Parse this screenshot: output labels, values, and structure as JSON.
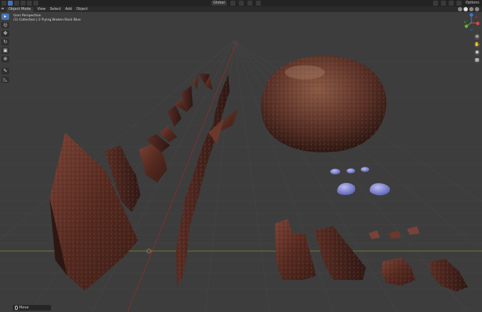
{
  "header": {
    "orientation_label": "Global",
    "options_label": "Options"
  },
  "menubar": {
    "mode": "Object Mode",
    "menus": [
      "View",
      "Select",
      "Add",
      "Object"
    ]
  },
  "viewport": {
    "perspective_label": "User Perspective",
    "collection_label": "(1) Collection | 2 Flying Broken Rock Blue"
  },
  "toolbar": {
    "tools": [
      {
        "name": "select-tool",
        "glyph": "▸",
        "active": true
      },
      {
        "name": "cursor-tool",
        "glyph": "◎",
        "active": false
      },
      {
        "name": "move-tool",
        "glyph": "✥",
        "active": false
      },
      {
        "name": "rotate-tool",
        "glyph": "↻",
        "active": false
      },
      {
        "name": "scale-tool",
        "glyph": "▣",
        "active": false
      },
      {
        "name": "transform-tool",
        "glyph": "⊕",
        "active": false
      },
      {
        "name": "annotate-tool",
        "glyph": "✎",
        "active": false
      },
      {
        "name": "measure-tool",
        "glyph": "◺",
        "active": false
      }
    ]
  },
  "navigation": {
    "buttons": [
      {
        "name": "zoom-icon",
        "glyph": "⊕"
      },
      {
        "name": "pan-hand-icon",
        "glyph": "✋"
      },
      {
        "name": "camera-icon",
        "glyph": "◉"
      },
      {
        "name": "grid-icon",
        "glyph": "▦"
      }
    ]
  },
  "status": {
    "label": "Move"
  },
  "colors": {
    "x_axis": "#8a2f2f",
    "y_axis": "#7d8f2a",
    "selection_blue": "#4772b3"
  }
}
